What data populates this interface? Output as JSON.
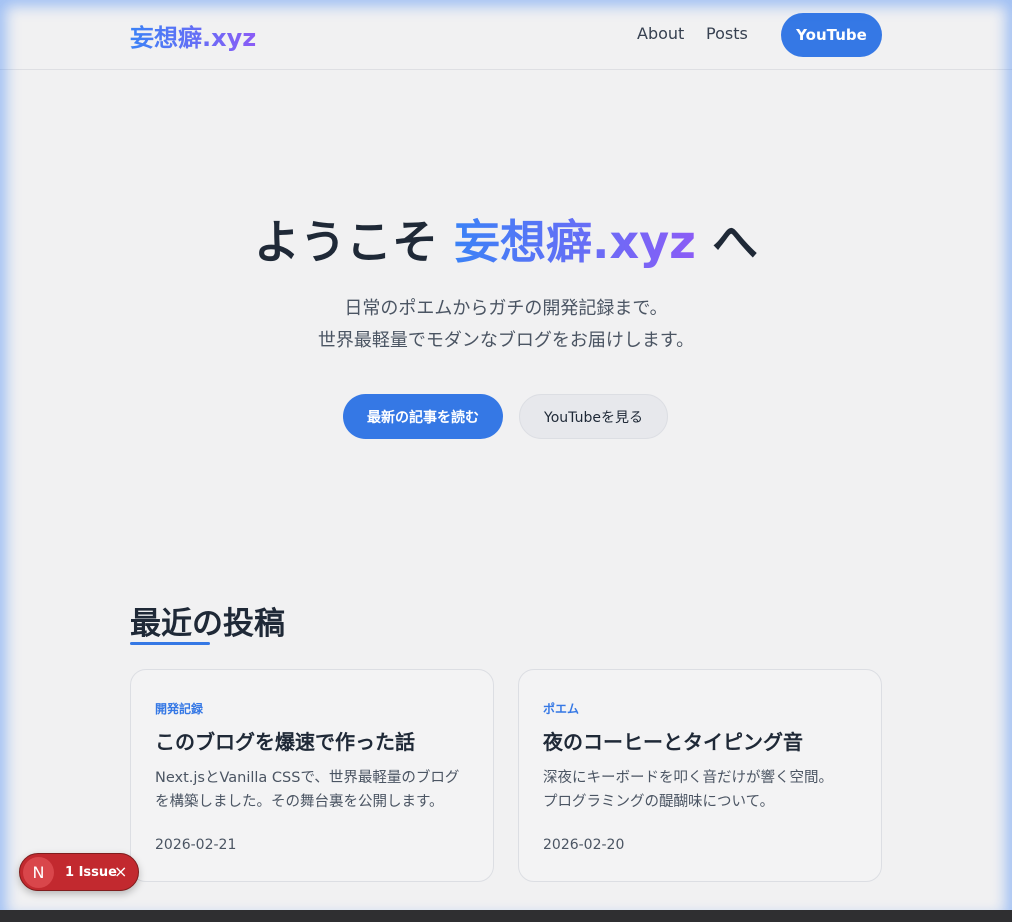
{
  "header": {
    "logo": "妄想癖.xyz",
    "nav": {
      "about": "About",
      "posts": "Posts",
      "youtube": "YouTube"
    }
  },
  "hero": {
    "title_prefix": "ようこそ ",
    "title_brand": "妄想癖.xyz",
    "title_suffix": " へ",
    "subtitle_line1": "日常のポエムからガチの開発記録まで。",
    "subtitle_line2": "世界最軽量でモダンなブログをお届けします。",
    "primary_button": "最新の記事を読む",
    "secondary_button": "YouTubeを見る"
  },
  "recent": {
    "heading": "最近の投稿",
    "posts": [
      {
        "category": "開発記録",
        "title": "このブログを爆速で作った話",
        "desc_line1": "Next.jsとVanilla CSSで、世界最軽量のブログ",
        "desc_line2": "を構築しました。その舞台裏を公開します。",
        "date": "2026-02-21"
      },
      {
        "category": "ポエム",
        "title": "夜のコーヒーとタイピング音",
        "desc_line1": "深夜にキーボードを叩く音だけが響く空間。",
        "desc_line2": "プログラミングの醍醐味について。",
        "date": "2026-02-20"
      }
    ]
  },
  "issue_badge": {
    "avatar_letter": "N",
    "label": "1 Issue",
    "close": "×"
  },
  "colors": {
    "accent": "#3578e5",
    "gradient_start": "#3b82f6",
    "gradient_end": "#8b5cf6",
    "issue_red": "#c2292f"
  }
}
